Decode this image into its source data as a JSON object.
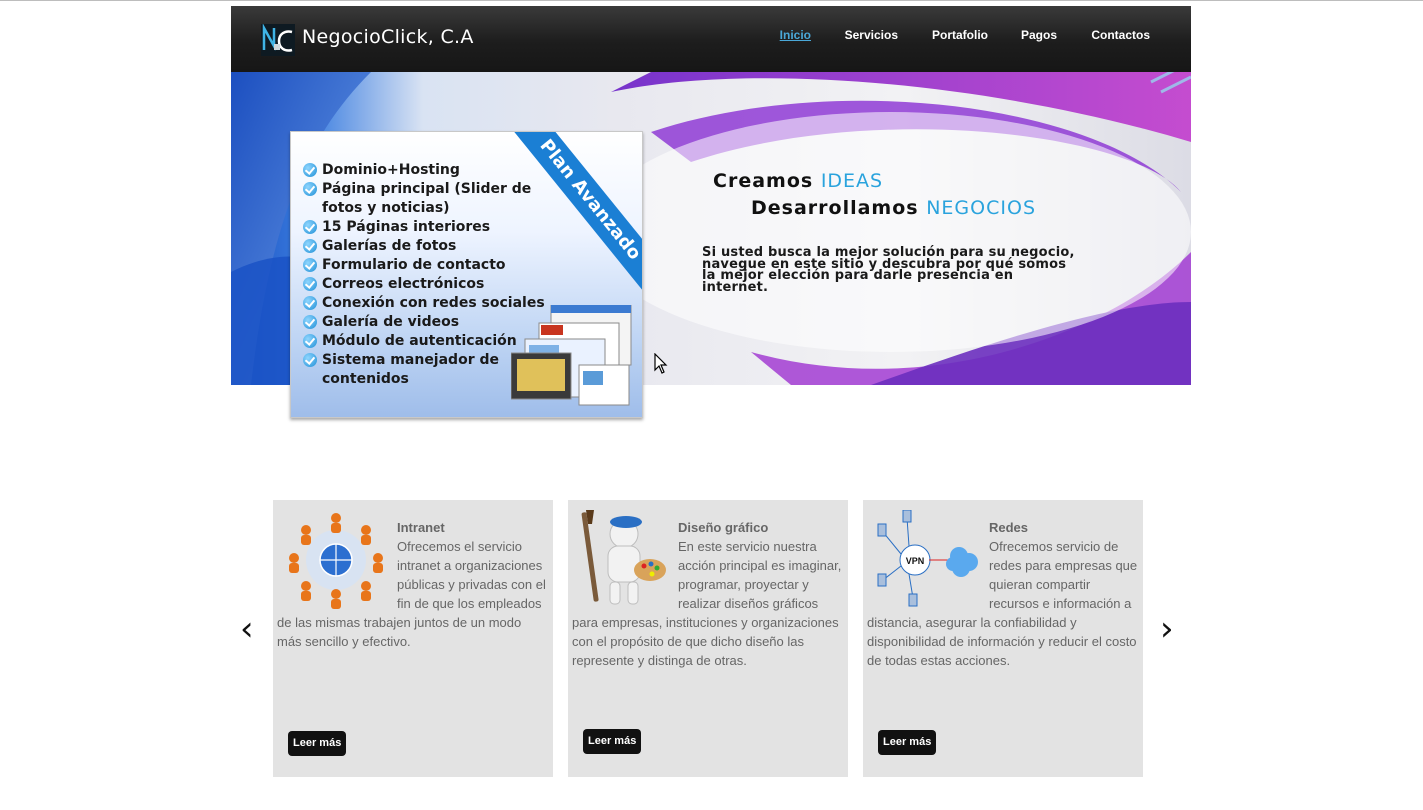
{
  "site": {
    "name": "NegocioClick, C.A",
    "logo_letters": "NC"
  },
  "nav": {
    "items": [
      {
        "label": "Inicio",
        "active": true
      },
      {
        "label": "Servicios",
        "active": false
      },
      {
        "label": "Portafolio",
        "active": false
      },
      {
        "label": "Pagos",
        "active": false
      },
      {
        "label": "Contactos",
        "active": false
      }
    ]
  },
  "banner": {
    "line1_prefix": "Creamos",
    "line1_highlight": "IDEAS",
    "line2_prefix": "Desarrollamos",
    "line2_highlight": "NEGOCIOS",
    "intro": "Si usted busca la mejor solución para su negocio, navegue en este sitio y descubra por qué somos la mejor elección para darle presencia en internet.",
    "plan": {
      "ribbon": "Plan Avanzado",
      "features": [
        "Dominio+Hosting",
        "Página principal (Slider de fotos y noticias)",
        "15 Páginas interiores",
        "Galerías de fotos",
        "Formulario de contacto",
        "Correos electrónicos",
        "Conexión con redes sociales",
        "Galería de videos",
        "Módulo de autenticación",
        "Sistema manejador de contenidos"
      ]
    }
  },
  "carousel": {
    "prev": "‹",
    "next": "›"
  },
  "services": [
    {
      "title": "Intranet",
      "description": "Ofrecemos el servicio intranet a organizaciones públicas y privadas con el fin de que los empleados de las mismas trabajen juntos de un modo más sencillo y efectivo.",
      "button": "Leer más"
    },
    {
      "title": "Diseño gráfico",
      "description": "En este servicio nuestra acción principal es imaginar, programar, proyectar y realizar diseños gráficos para empresas, instituciones y organizaciones con el propósito de que dicho diseño las represente y distinga de otras.",
      "button": "Leer más"
    },
    {
      "title": "Redes",
      "description": "Ofrecemos servicio de redes para empresas que quieran compartir recursos e información a distancia, asegurar la confiabilidad y disponibilidad de información y reducir el costo de todas estas acciones.",
      "button": "Leer más",
      "image_label": "VPN"
    }
  ],
  "colors": {
    "header_bg": "#1d1d1d",
    "nav_active": "#4aa8d8",
    "highlight": "#2aa3dd",
    "card_bg": "#e3e3e3",
    "ribbon": "#1b7fd4"
  }
}
